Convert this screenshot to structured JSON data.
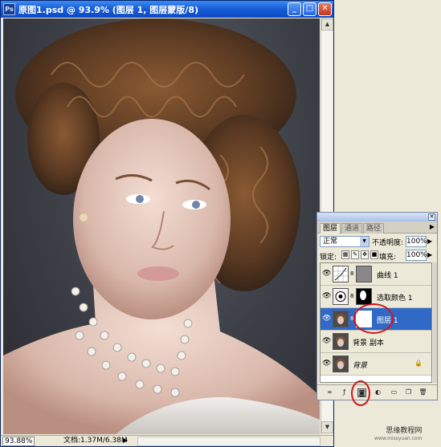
{
  "window": {
    "title": "原图1.psd @ 93.9% (图层 1, 图层蒙版/8)",
    "icon_text": "Ps"
  },
  "status_bar": {
    "zoom": "93.88%",
    "doc_info": "文档:1.37M/6.38M"
  },
  "layers_panel": {
    "tabs": [
      "图层",
      "通道",
      "路径"
    ],
    "blend_mode": "正常",
    "opacity_label": "不透明度:",
    "opacity": "100%",
    "lock_label": "锁定:",
    "fill_label": "填充:",
    "fill": "100%",
    "layers": [
      {
        "name": "曲线 1",
        "thumb_icon": "curves-adjustment-icon",
        "has_mask": true,
        "selected": false
      },
      {
        "name": "选取颜色 1",
        "thumb_icon": "selective-color-adjustment-icon",
        "has_mask": true,
        "selected": false
      },
      {
        "name": "图层 1",
        "thumb_icon": "portrait-thumbnail",
        "has_mask": true,
        "selected": true
      },
      {
        "name": "背景 副本",
        "thumb_icon": "portrait-thumbnail",
        "has_mask": false,
        "selected": false
      },
      {
        "name": "背景",
        "thumb_icon": "portrait-thumbnail",
        "has_mask": false,
        "selected": false,
        "locked": true
      }
    ],
    "footer_icons": [
      "link-layers-icon",
      "layer-style-icon",
      "add-mask-icon",
      "adjustment-layer-icon",
      "new-group-icon",
      "new-layer-icon",
      "delete-layer-icon"
    ]
  },
  "watermark": {
    "line1": "思缘教程网",
    "line2": "www.missyuan.com"
  },
  "colors": {
    "titlebar": "#0b49c4",
    "selected_layer": "#3169c6",
    "annotation_red": "#d0151b"
  }
}
